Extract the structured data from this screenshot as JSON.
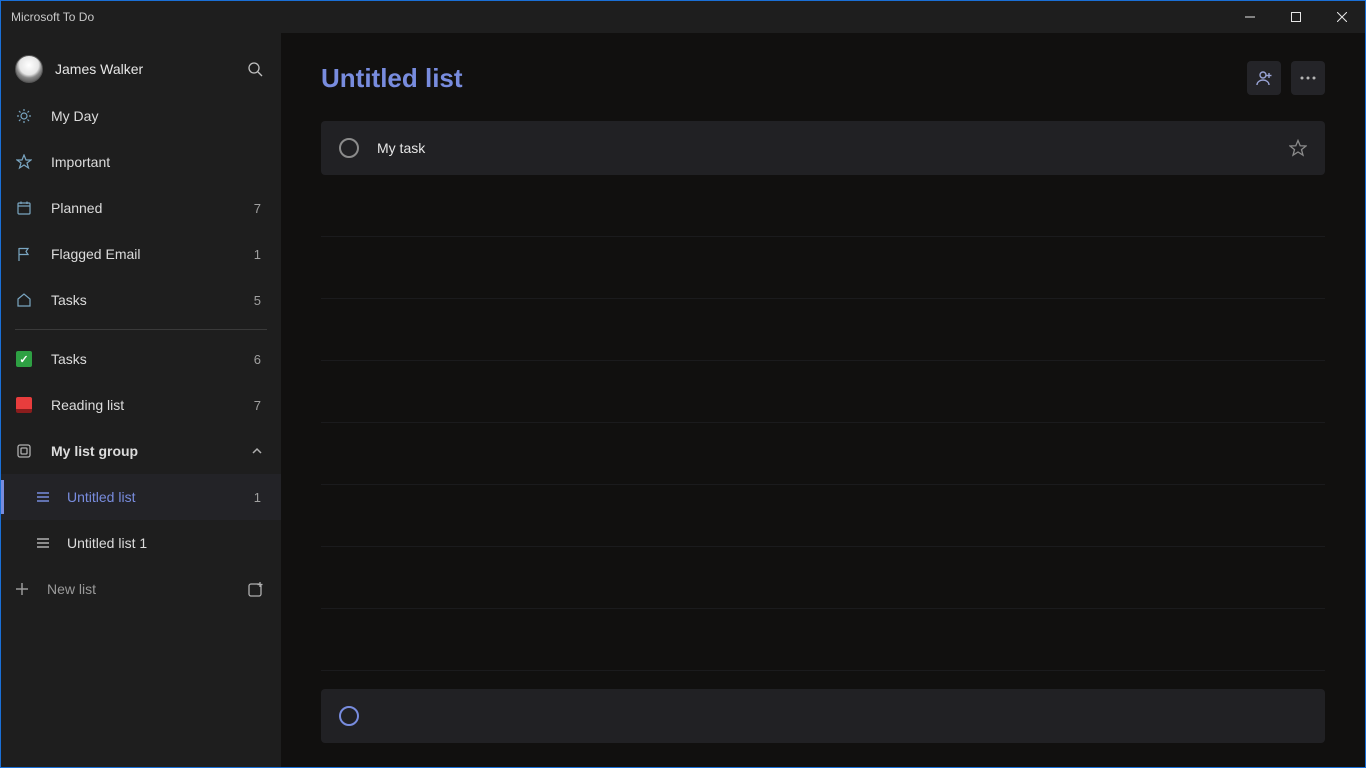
{
  "window": {
    "title": "Microsoft To Do"
  },
  "user": {
    "name": "James Walker"
  },
  "sidebar": {
    "smart": [
      {
        "icon": "sun",
        "label": "My Day",
        "count": ""
      },
      {
        "icon": "star",
        "label": "Important",
        "count": ""
      },
      {
        "icon": "cal",
        "label": "Planned",
        "count": "7"
      },
      {
        "icon": "flag",
        "label": "Flagged Email",
        "count": "1"
      },
      {
        "icon": "home",
        "label": "Tasks",
        "count": "5"
      }
    ],
    "lists": [
      {
        "iconColor": "green",
        "label": "Tasks",
        "count": "6"
      },
      {
        "iconColor": "red",
        "label": "Reading list",
        "count": "7"
      }
    ],
    "group": {
      "label": "My list group",
      "items": [
        {
          "label": "Untitled list",
          "count": "1",
          "active": true
        },
        {
          "label": "Untitled list 1",
          "count": "",
          "active": false
        }
      ]
    },
    "newList": "New list"
  },
  "main": {
    "title": "Untitled list",
    "tasks": [
      {
        "title": "My task",
        "completed": false,
        "starred": false
      }
    ],
    "addPlaceholder": ""
  },
  "colors": {
    "accent": "#788cde",
    "sidebarBg": "#1e1e1e",
    "mainBg": "#11100f",
    "rowBg": "#212124"
  }
}
